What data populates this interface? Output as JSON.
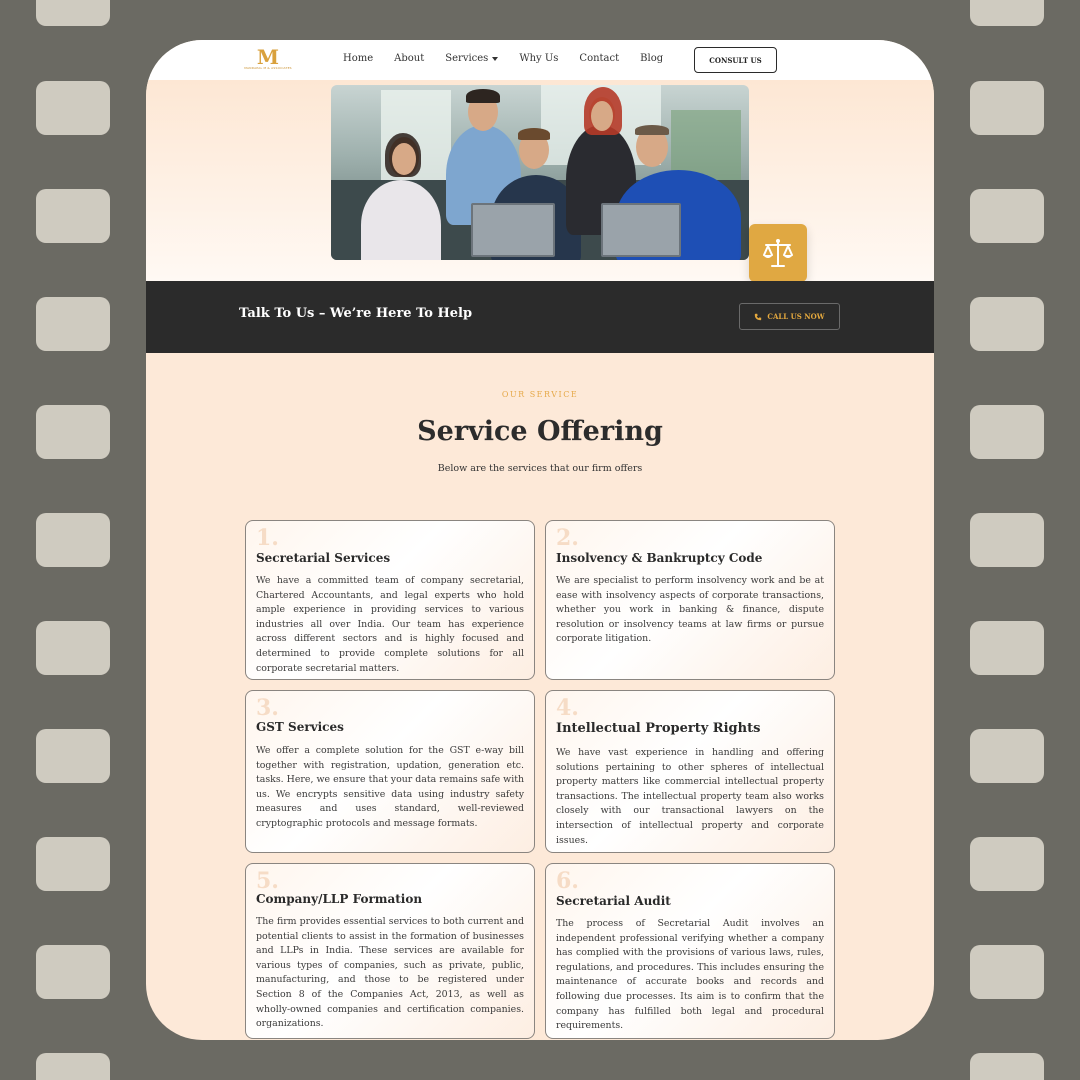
{
  "nav": {
    "logo_mark": "M",
    "logo_sub": "MANDAPAL M & ASSOCIATES",
    "items": [
      {
        "label": "Home"
      },
      {
        "label": "About"
      },
      {
        "label": "Services"
      },
      {
        "label": "Why Us"
      },
      {
        "label": "Contact"
      },
      {
        "label": "Blog"
      }
    ],
    "consult_label": "CONSULT US"
  },
  "hero": {
    "badge_icon": "scales-of-justice-icon",
    "badge_color": "#e0a842"
  },
  "strip": {
    "title": "Talk To Us – We’re Here To Help",
    "call_label": "CALL US NOW",
    "call_icon": "phone-icon",
    "accent": "#e5a93e"
  },
  "section": {
    "eyebrow": "OUR SERVICE",
    "title": "Service Offering",
    "subtitle": "Below are the services that our firm offers"
  },
  "services": [
    {
      "num": "1.",
      "title": "Secretarial Services",
      "text": "We have a committed team of company secretarial, Chartered Accountants, and legal experts who hold ample experience in providing services to various industries all over India. Our team has experience across different sectors and is highly focused and determined to provide complete solutions for all corporate secretarial matters."
    },
    {
      "num": "2.",
      "title": "Insolvency & Bankruptcy Code",
      "text": "We are specialist to perform insolvency work and be at ease with insolvency aspects of corporate transactions, whether you work in banking & finance, dispute resolution or insolvency teams at law firms or pursue corporate litigation."
    },
    {
      "num": "3.",
      "title": "GST Services",
      "text": "We offer a complete solution for the GST e-way bill together with registration, updation, generation etc. tasks. Here, we ensure that your data remains safe with us. We encrypts sensitive data using industry safety measures and uses standard, well-reviewed cryptographic protocols and message formats."
    },
    {
      "num": "4.",
      "title": "Intellectual Property Rights",
      "text": "We have vast experience in handling and offering solutions pertaining to other spheres of intellectual property matters like commercial intellectual property transactions. The intellectual property team also works closely with our transactional lawyers on the intersection of intellectual property and corporate issues."
    },
    {
      "num": "5.",
      "title": "Company/LLP Formation",
      "text": "The firm provides essential services to both current and potential clients to assist in the formation of businesses and LLPs in India. These services are available for various types of companies, such as private, public, manufacturing, and those to be registered under Section 8 of the Companies Act, 2013, as well as wholly-owned companies and certification companies. organizations."
    },
    {
      "num": "6.",
      "title": "Secretarial Audit",
      "text": "The process of Secretarial Audit involves an independent professional verifying whether a company has complied with the provisions of various laws, rules, regulations, and procedures. This includes ensuring the maintenance of accurate books and records and following due processes. Its aim is to confirm that the company has fulfilled both legal and procedural requirements."
    }
  ]
}
